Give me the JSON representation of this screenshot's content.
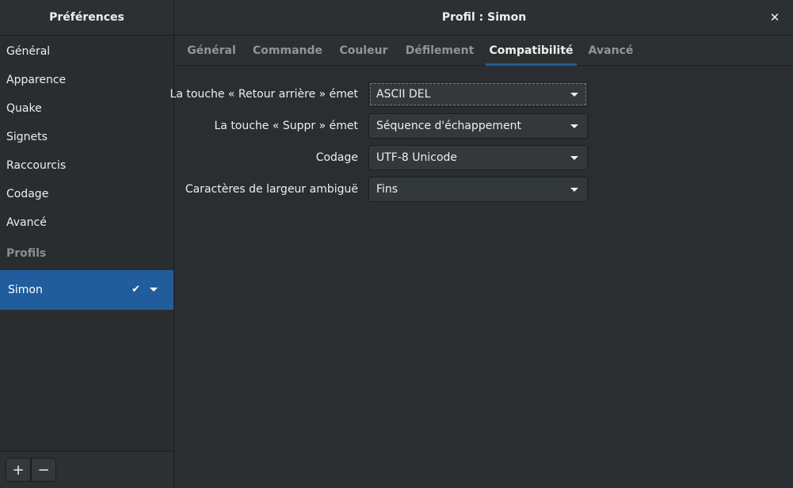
{
  "header": {
    "left_title": "Préférences",
    "right_title": "Profil : Simon",
    "close_glyph": "✕"
  },
  "sidebar": {
    "items": [
      {
        "label": "Général"
      },
      {
        "label": "Apparence"
      },
      {
        "label": "Quake"
      },
      {
        "label": "Signets"
      },
      {
        "label": "Raccourcis"
      },
      {
        "label": "Codage"
      },
      {
        "label": "Avancé"
      }
    ],
    "profiles_heading": "Profils",
    "profiles": [
      {
        "label": "Simon",
        "default_icon": "checkmark-icon",
        "menu_icon": "chevron-down-icon",
        "selected": true
      }
    ],
    "footer": {
      "add_label": "+",
      "remove_label": "−"
    }
  },
  "tabs": [
    {
      "label": "Général",
      "active": false
    },
    {
      "label": "Commande",
      "active": false
    },
    {
      "label": "Couleur",
      "active": false
    },
    {
      "label": "Défilement",
      "active": false
    },
    {
      "label": "Compatibilité",
      "active": true
    },
    {
      "label": "Avancé",
      "active": false
    }
  ],
  "form": {
    "rows": [
      {
        "label": "La touche « Retour arrière » émet",
        "value": "ASCII DEL",
        "focused": true
      },
      {
        "label": "La touche « Suppr » émet",
        "value": "Séquence d'échappement",
        "focused": false
      },
      {
        "label": "Codage",
        "value": "UTF-8 Unicode",
        "focused": false
      },
      {
        "label": "Caractères de largeur ambiguë",
        "value": "Fins",
        "focused": false
      }
    ]
  },
  "colors": {
    "accent": "#215d9c",
    "background": "#2b2e30",
    "text": "#eeeeec",
    "inactive_text": "#919596"
  }
}
